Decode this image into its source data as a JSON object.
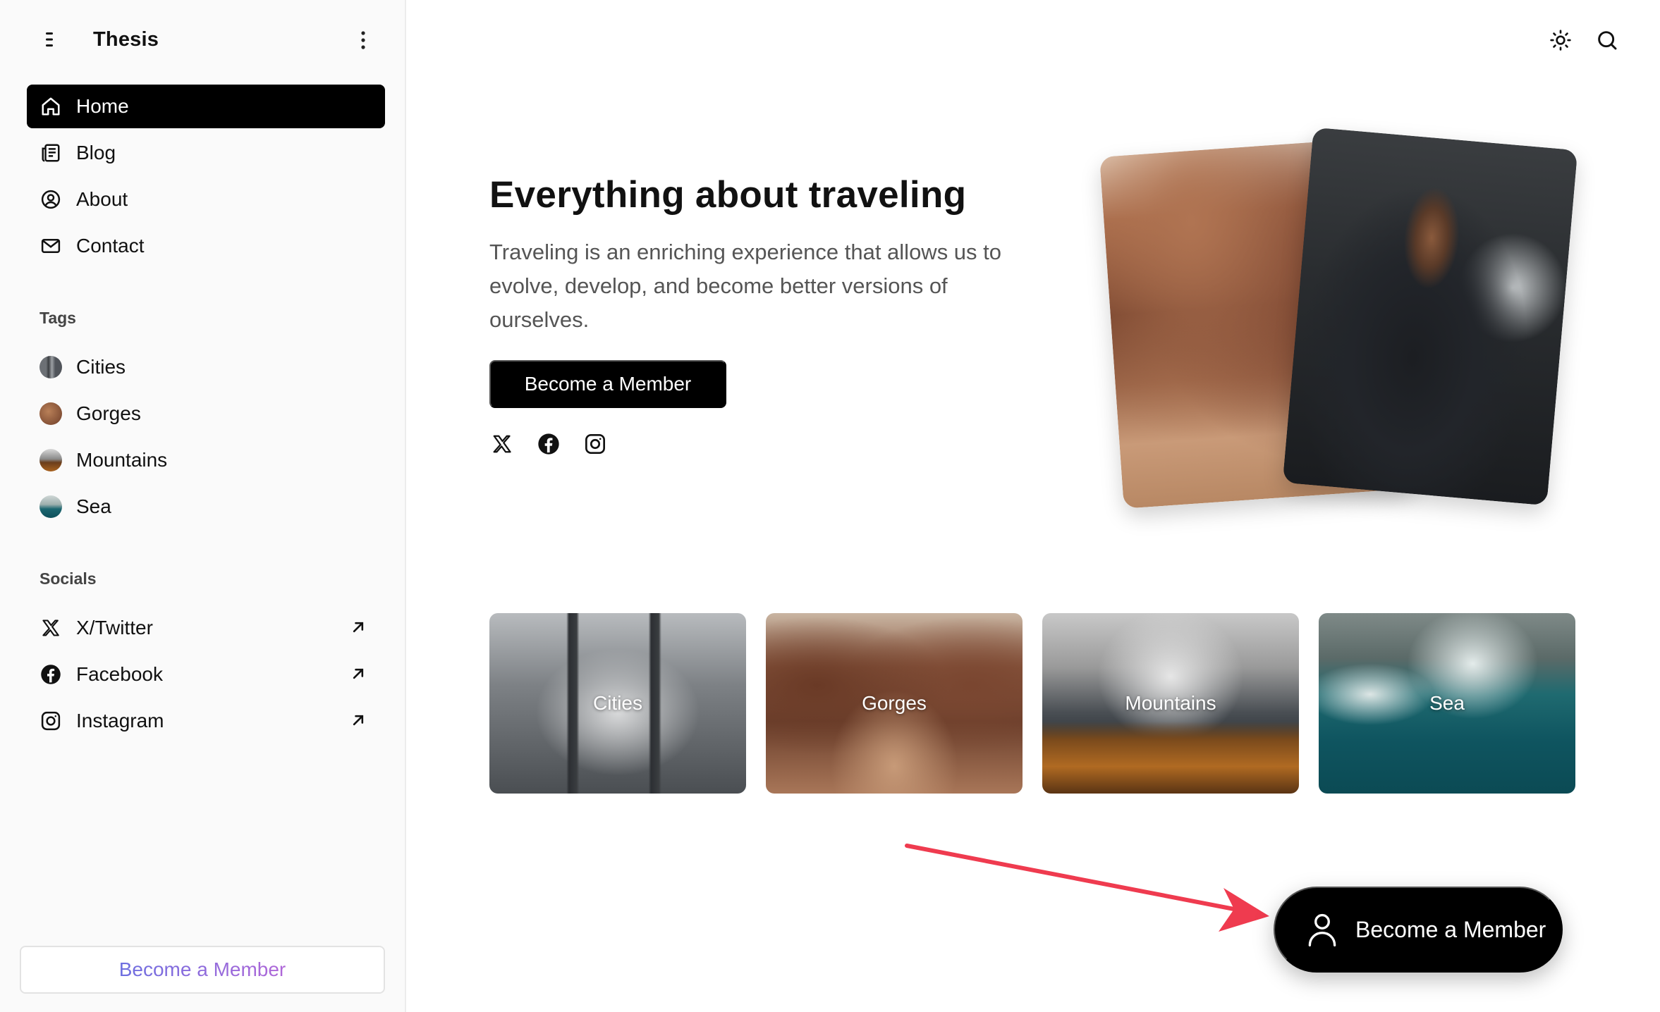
{
  "sidebar": {
    "brand_title": "Thesis",
    "nav": [
      {
        "label": "Home",
        "icon": "home-icon",
        "active": true
      },
      {
        "label": "Blog",
        "icon": "blog-icon",
        "active": false
      },
      {
        "label": "About",
        "icon": "user-circle-icon",
        "active": false
      },
      {
        "label": "Contact",
        "icon": "mail-icon",
        "active": false
      }
    ],
    "tags_heading": "Tags",
    "tags": [
      {
        "label": "Cities"
      },
      {
        "label": "Gorges"
      },
      {
        "label": "Mountains"
      },
      {
        "label": "Sea"
      }
    ],
    "socials_heading": "Socials",
    "socials": [
      {
        "label": "X/Twitter",
        "icon": "x-twitter-icon"
      },
      {
        "label": "Facebook",
        "icon": "facebook-icon"
      },
      {
        "label": "Instagram",
        "icon": "instagram-icon"
      }
    ],
    "member_label": "Become a Member"
  },
  "header": {
    "theme_icon": "sun-icon",
    "search_icon": "search-icon"
  },
  "hero": {
    "title": "Everything about traveling",
    "text": "Traveling is an enriching experience that allows us to evolve, develop, and become better versions of ourselves.",
    "button_label": "Become a Member"
  },
  "tag_cards": [
    {
      "label": "Cities"
    },
    {
      "label": "Gorges"
    },
    {
      "label": "Mountains"
    },
    {
      "label": "Sea"
    }
  ],
  "floating_button": {
    "label": "Become a Member",
    "icon": "user-icon"
  },
  "colors": {
    "accent": "#000000",
    "member_gradient_start": "#6d6fe0",
    "member_gradient_end": "#b067d8",
    "annotation_arrow": "#ef3b4f"
  }
}
